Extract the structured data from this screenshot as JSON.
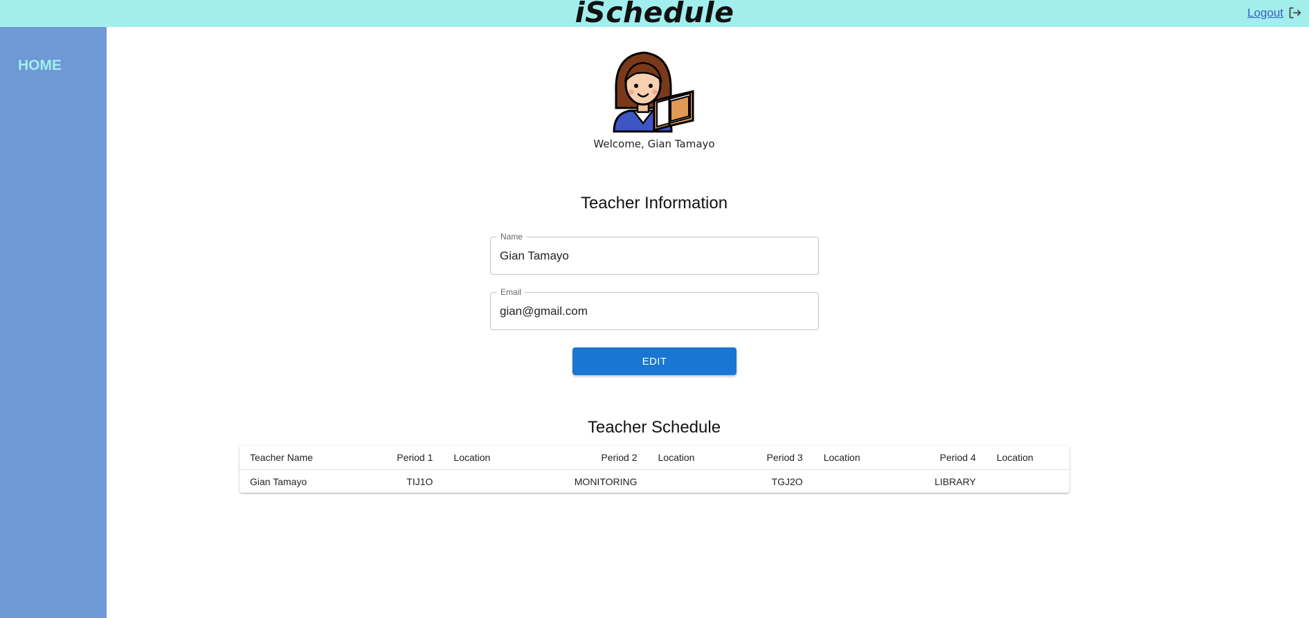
{
  "header": {
    "app_title": "iSchedule",
    "logout_label": "Logout",
    "logout_icon": "logout-icon"
  },
  "sidebar": {
    "items": [
      {
        "label": "HOME"
      }
    ]
  },
  "profile": {
    "avatar_icon": "teacher-reading-avatar",
    "welcome_text": "Welcome, Gian Tamayo"
  },
  "teacher_info": {
    "title": "Teacher Information",
    "name_label": "Name",
    "name_value": "Gian Tamayo",
    "email_label": "Email",
    "email_value": "gian@gmail.com",
    "edit_label": "EDIT"
  },
  "schedule": {
    "title": "Teacher Schedule",
    "columns": [
      "Teacher Name",
      "Period 1",
      "Location",
      "Period 2",
      "Location",
      "Period 3",
      "Location",
      "Period 4",
      "Location"
    ],
    "rows": [
      [
        "Gian Tamayo",
        "TIJ1O",
        "",
        "MONITORING",
        "",
        "TGJ2O",
        "",
        "LIBRARY",
        ""
      ]
    ]
  },
  "colors": {
    "header_bg": "#a2eeec",
    "sidebar_bg": "#6e98d6",
    "sidebar_text": "#a2eeec",
    "button_bg": "#1976d2",
    "link": "#3b5fc0"
  }
}
